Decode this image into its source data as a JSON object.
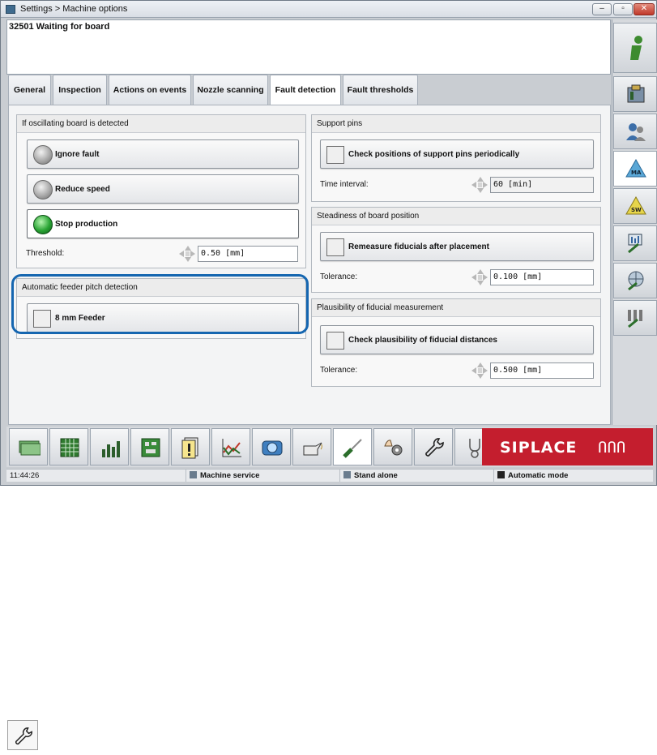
{
  "window": {
    "title": "Settings > Machine options",
    "buttons": [
      "minimize",
      "maximize",
      "close"
    ]
  },
  "message": "32501 Waiting for board",
  "tabs": [
    {
      "label": "General",
      "active": false
    },
    {
      "label": "Inspection",
      "active": false
    },
    {
      "label": "Actions on events",
      "active": false
    },
    {
      "label": "Nozzle scanning",
      "active": false
    },
    {
      "label": "Fault detection",
      "active": true
    },
    {
      "label": "Fault thresholds",
      "active": false
    }
  ],
  "oscillating": {
    "title": "If oscillating board is detected",
    "options": [
      {
        "label": "Ignore fault",
        "selected": false
      },
      {
        "label": "Reduce speed",
        "selected": false
      },
      {
        "label": "Stop production",
        "selected": true
      }
    ],
    "threshold_label": "Threshold:",
    "threshold_value": "0.50 [mm]"
  },
  "feeder_pitch": {
    "title": "Automatic feeder pitch detection",
    "option": {
      "label": "8 mm Feeder",
      "checked": false
    }
  },
  "support_pins": {
    "title": "Support pins",
    "option": {
      "label": "Check positions of support pins periodically",
      "checked": false
    },
    "interval_label": "Time interval:",
    "interval_value": "60 [min]"
  },
  "steadiness": {
    "title": "Steadiness of board position",
    "option": {
      "label": "Remeasure fiducials after placement",
      "checked": false
    },
    "tolerance_label": "Tolerance:",
    "tolerance_value": "0.100 [mm]"
  },
  "plausibility": {
    "title": "Plausibility of fiducial measurement",
    "option": {
      "label": "Check plausibility of fiducial distances",
      "checked": false
    },
    "tolerance_label": "Tolerance:",
    "tolerance_value": "0.500 [mm]"
  },
  "right_toolbar": [
    "info-icon",
    "machine-icon",
    "users-icon",
    "ma-icon",
    "sw-icon",
    "monitor-tools-icon",
    "globe-tools-icon",
    "feeder-tools-icon"
  ],
  "bottom_toolbar": [
    "money-icon",
    "grid-icon",
    "bar-chart-icon",
    "board-icon",
    "warning-docs-icon",
    "line-chart-icon",
    "camera-icon",
    "oil-can-icon",
    "screwdriver-icon",
    "hand-gear-icon",
    "wrench-icon",
    "stethoscope-icon"
  ],
  "brand": {
    "name": "SIPLACE",
    "mark": "ՈՈՈ",
    "color": "#c41e2e"
  },
  "status": {
    "time": "11:44:26",
    "user": "Machine service",
    "mode1": "Stand alone",
    "mode2": "Automatic mode"
  },
  "colors": {
    "highlight": "#1566b0",
    "led_on": "#29a434"
  }
}
